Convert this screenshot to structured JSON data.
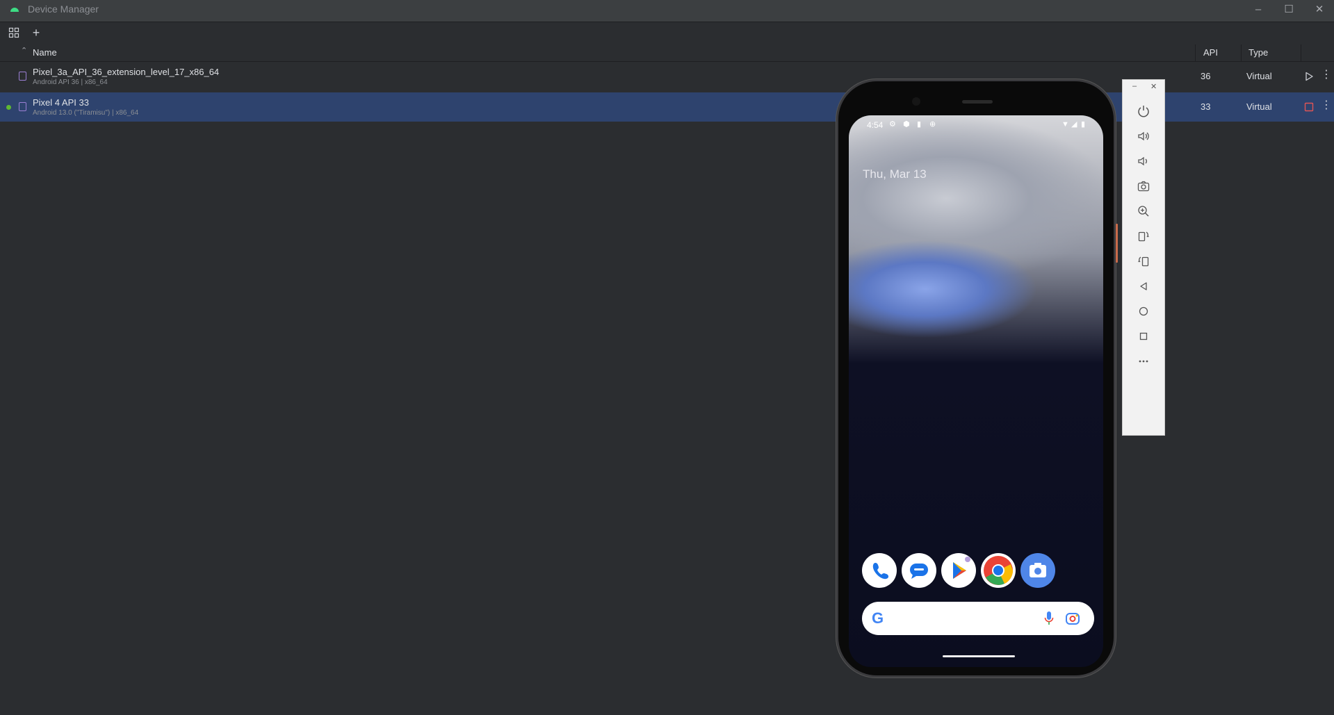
{
  "window": {
    "title": "Device Manager",
    "minimize_icon": "minimize-icon",
    "maximize_icon": "maximize-icon",
    "close_icon": "close-icon"
  },
  "toolbar": {
    "layout_icon": "grid-layout-icon",
    "add_label": "+"
  },
  "table": {
    "headers": {
      "name": "Name",
      "api": "API",
      "type": "Type"
    },
    "sort_icon": "chevron-up-icon",
    "rows": [
      {
        "name": "Pixel_3a_API_36_extension_level_17_x86_64",
        "subtitle": "Android API 36 | x86_64",
        "api": "36",
        "type": "Virtual",
        "action_icon": "play-icon",
        "running": false
      },
      {
        "name": "Pixel 4 API 33",
        "subtitle": "Android 13.0 (\"Tiramisu\") | x86_64",
        "api": "33",
        "type": "Virtual",
        "action_icon": "stop-icon",
        "running": true
      }
    ]
  },
  "emulator": {
    "status_time": "4:54",
    "date": "Thu, Mar 13",
    "dock_apps": [
      "phone-app-icon",
      "messages-app-icon",
      "play-store-app-icon",
      "chrome-app-icon",
      "camera-app-icon"
    ],
    "search_logo": "G",
    "colors": {
      "accent_blue": "#1a73e8",
      "google_red": "#ea4335",
      "google_yellow": "#fbbc04",
      "google_green": "#34a853"
    }
  },
  "panel": {
    "controls": [
      "power-icon",
      "volume-up-icon",
      "volume-down-icon",
      "screenshot-camera-icon",
      "zoom-icon",
      "rotate-left-icon",
      "rotate-right-icon",
      "back-icon",
      "home-icon",
      "overview-icon",
      "more-icon"
    ]
  },
  "colors": {
    "background": "#2b2d30",
    "selected_row": "#2e436e",
    "running_dot": "#5fb832",
    "stop_red": "#e05555"
  }
}
